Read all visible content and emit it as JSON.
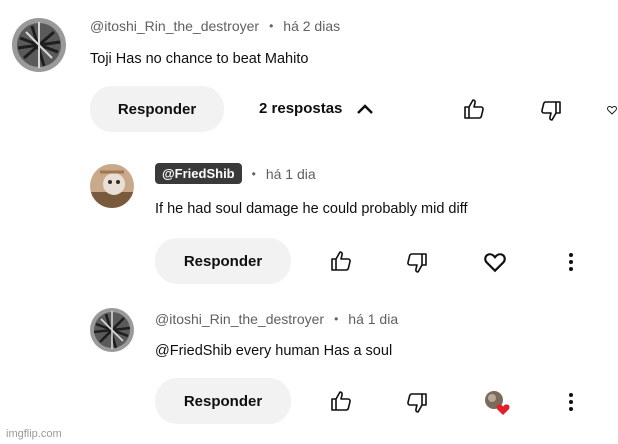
{
  "comment": {
    "author": "@itoshi_Rin_the_destroyer",
    "time": "há 2 dias",
    "text": "Toji Has no chance to beat Mahito",
    "reply_button": "Responder",
    "replies_toggle": "2 respostas"
  },
  "replies": [
    {
      "author": "@FriedShib",
      "time": "há 1 dia",
      "text": "If he had soul damage he could probably mid diff",
      "reply_button": "Responder"
    },
    {
      "author": "@itoshi_Rin_the_destroyer",
      "time": "há 1 dia",
      "text": "@FriedShib every human Has a soul",
      "reply_button": "Responder"
    }
  ],
  "separator": "•",
  "watermark": "imgflip.com",
  "icons": {
    "like": "thumbs-up-icon",
    "dislike": "thumbs-down-icon",
    "heart": "heart-icon",
    "more": "more-vert-icon",
    "chevron": "chevron-up-icon",
    "creator_heart": "creator-heart-icon"
  },
  "colors": {
    "meta_text": "#606060",
    "pill_bg": "#f2f2f2",
    "badge_bg": "#3a3a3a",
    "heart_red": "#e0202a"
  }
}
